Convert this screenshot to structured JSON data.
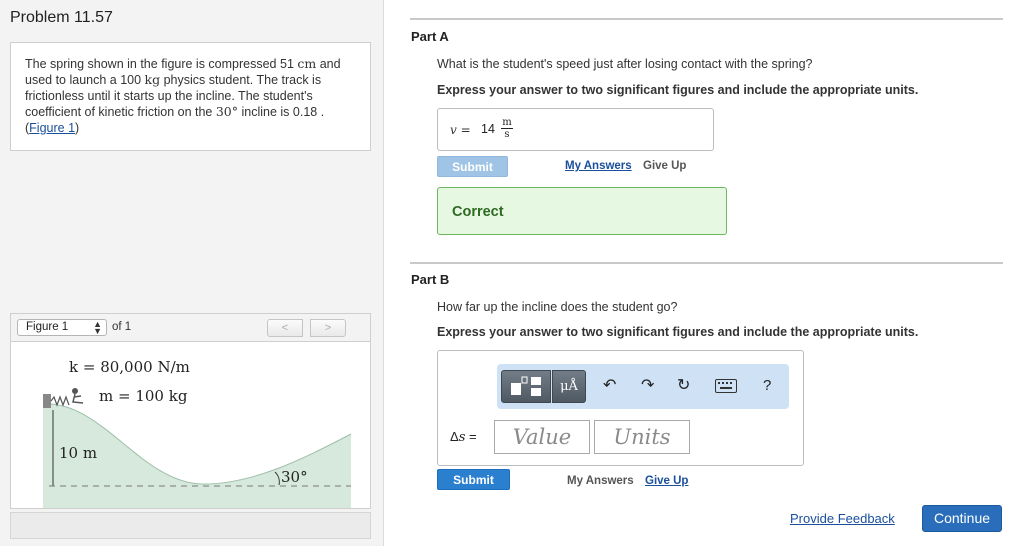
{
  "problem": {
    "title": "Problem 11.57",
    "statement_1": "The spring shown in the figure is compressed 51 ",
    "unit_cm": "cm",
    "statement_2": " and used to launch a 100 ",
    "unit_kg": "kg",
    "statement_3": " physics student. The track is frictionless until it starts up the incline. The student's coefficient of kinetic friction on the ",
    "angle_value": "30°",
    "statement_4": " incline is 0.18 .",
    "figure_link_open": "(",
    "figure_link": "Figure 1",
    "figure_link_close": ")"
  },
  "figure": {
    "selector": "Figure 1",
    "of_label": "of 1",
    "prev_icon": "chevron-left-icon",
    "next_icon": "chevron-right-icon",
    "k_label": "k = 80,000 N/m",
    "m_label": "m = 100 kg",
    "height_label": "10 m",
    "angle_label": "30°"
  },
  "partA": {
    "title": "Part A",
    "question": "What is the student's speed just after losing contact with the spring?",
    "instruction": "Express your answer to two significant figures and include the appropriate units.",
    "var": "v",
    "eq": " = ",
    "value": "14",
    "unit_num": "m",
    "unit_den": "s",
    "submit": "Submit",
    "my_answers": "My Answers",
    "give_up": "Give Up",
    "result": "Correct"
  },
  "partB": {
    "title": "Part B",
    "question": "How far up the incline does the student go?",
    "instruction": "Express your answer to two significant figures and include the appropriate units.",
    "label_delta": "Δ",
    "label_var": "s",
    "label_eq": " =",
    "value_placeholder": "Value",
    "units_placeholder": "Units",
    "submit": "Submit",
    "my_answers": "My Answers",
    "give_up": "Give Up",
    "toolbar": {
      "mu_label": "μÅ",
      "help": "?",
      "icons": [
        "templates-icon",
        "units-icon",
        "undo-icon",
        "redo-icon",
        "reset-icon",
        "keyboard-icon",
        "help-icon"
      ]
    }
  },
  "footer": {
    "feedback": "Provide Feedback",
    "continue": "Continue"
  },
  "colors": {
    "link": "#1a4f9c",
    "submit_active": "#2a80cf",
    "submit_disabled": "#9fc4e6",
    "correct_bg": "#e6f7e2",
    "correct_border": "#6cb85e",
    "toolbar_bg": "#cfe1f5",
    "track_fill": "#d7e8dc"
  }
}
